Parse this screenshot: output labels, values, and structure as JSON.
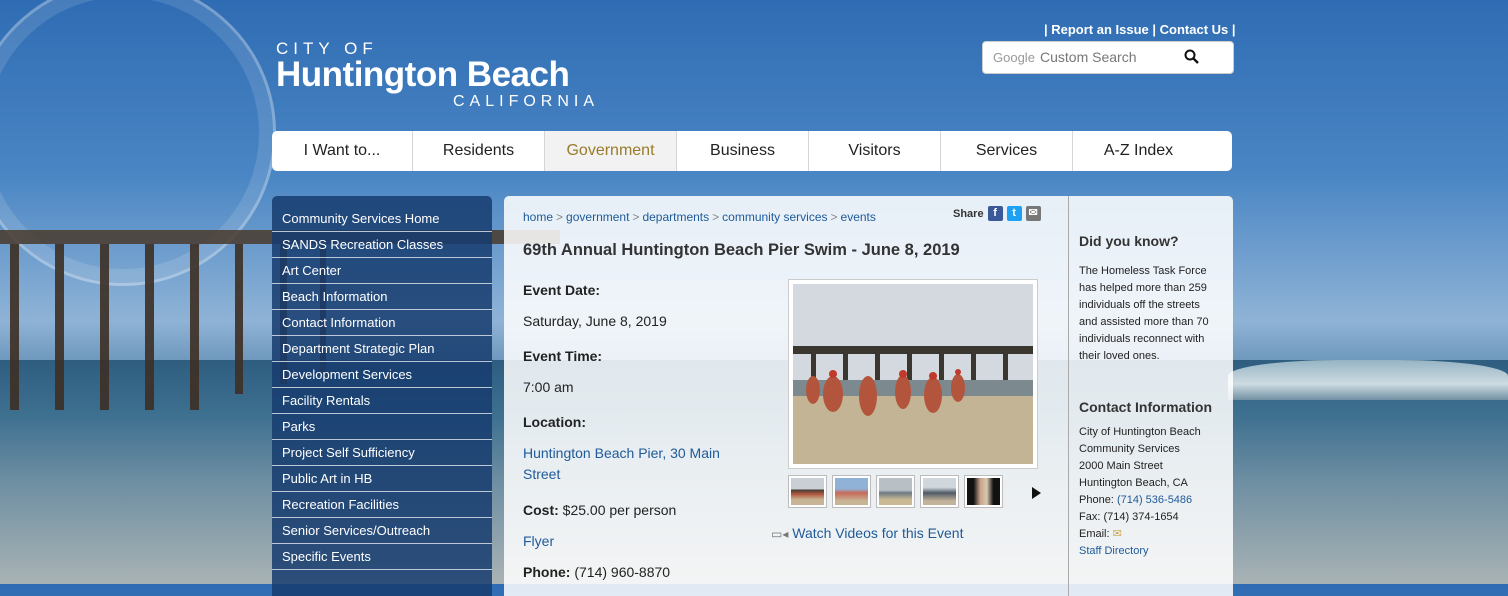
{
  "header": {
    "logo": {
      "line1": "CITY OF",
      "line2": "Huntington Beach",
      "line3": "CALIFORNIA"
    },
    "util_links": {
      "report": "Report an Issue",
      "contact": "Contact Us"
    },
    "search": {
      "brand": "Google",
      "placeholder": "Custom Search"
    }
  },
  "nav": [
    "I Want to...",
    "Residents",
    "Government",
    "Business",
    "Visitors",
    "Services",
    "A-Z Index"
  ],
  "sidebar": [
    "Community Services Home",
    "SANDS Recreation Classes",
    "Art Center",
    "Beach Information",
    "Contact Information",
    "Department Strategic Plan",
    "Development Services",
    "Facility Rentals",
    "Parks",
    "Project Self Sufficiency",
    "Public Art in HB",
    "Recreation Facilities",
    "Senior Services/Outreach",
    "Specific Events"
  ],
  "breadcrumb": [
    "home",
    "government",
    "departments",
    "community services",
    "events"
  ],
  "share_label": "Share",
  "event": {
    "title": "69th Annual Huntington Beach Pier Swim - June 8, 2019",
    "date_label": "Event Date:",
    "date": "Saturday, June 8, 2019",
    "time_label": "Event Time:",
    "time": "7:00 am",
    "location_label": "Location:",
    "location_line1": "Huntington Beach Pier, 30 Main",
    "location_line2": "Street",
    "cost_label": "Cost:",
    "cost": "$25.00 per person",
    "flyer": "Flyer",
    "phone_label": "Phone:",
    "phone": "(714) 960-8870",
    "videos_link": "Watch Videos for this Event"
  },
  "did_you_know": {
    "heading": "Did you know?",
    "lines": [
      "The Homeless Task Force",
      "has helped more than 259",
      "individuals off the streets",
      "and assisted more than 70",
      "individuals reconnect with",
      "their loved ones."
    ]
  },
  "contact": {
    "heading": "Contact Information",
    "org1": "City of Huntington Beach",
    "org2": "Community Services",
    "address1": "2000 Main Street",
    "address2": "Huntington Beach, CA",
    "phone_label": "Phone:",
    "phone": "(714) 536-5486",
    "fax": "Fax: (714) 374-1654",
    "email_label": "Email:",
    "staff_directory": "Staff Directory"
  },
  "colors": {
    "nav_active": "#9a7b2b",
    "link": "#1f5a99",
    "sidebar_bg": "#163c6e"
  }
}
